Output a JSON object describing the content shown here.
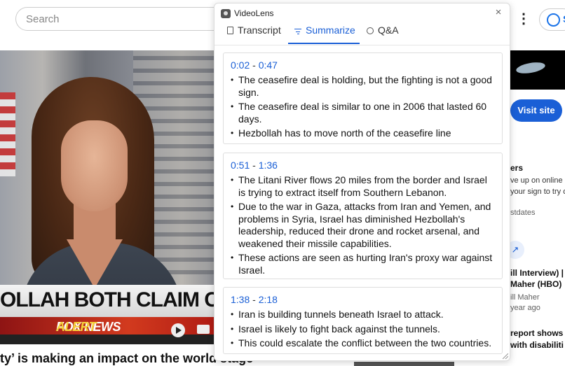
{
  "search": {
    "placeholder": "Search"
  },
  "video": {
    "lower_third": "OLLAH BOTH CLAIM CEASEFIRE",
    "alert_brand": "FOX NEWS",
    "alert_word": "ALERT",
    "title": "ty’ is making an impact on the world stage"
  },
  "side": {
    "visit_site": "Visit site",
    "lines": [
      "ers",
      "ve up on online",
      "your sign to try or",
      "stdates",
      "ill Interview) | R",
      "Maher (HBO)",
      "ill Maher",
      "year ago",
      "report shows",
      "with disabiliti"
    ],
    "profile_initial": "S"
  },
  "popup": {
    "app_title": "VideoLens",
    "tabs": [
      {
        "label": "Transcript",
        "active": false
      },
      {
        "label": "Summarize",
        "active": true
      },
      {
        "label": "Q&A",
        "active": false
      }
    ],
    "sections": [
      {
        "start": "0:02",
        "end": "0:47",
        "points": [
          "The ceasefire deal is holding, but the fighting is not a good sign.",
          "The ceasefire deal is similar to one in 2006 that lasted 60 days.",
          "Hezbollah has to move north of the ceasefire line"
        ]
      },
      {
        "start": "0:51",
        "end": "1:36",
        "points": [
          "The Litani River flows 20 miles from the border and Israel is trying to extract itself from Southern Lebanon.",
          "Due to the war in Gaza, attacks from Iran and Yemen, and problems in Syria, Israel has diminished Hezbollah's leadership, reduced their drone and rocket arsenal, and weakened their missile capabilities.",
          "These actions are seen as hurting Iran's proxy war against Israel."
        ]
      },
      {
        "start": "1:38",
        "end": "2:18",
        "points": [
          "Iran is building tunnels beneath Israel to attack.",
          "Israel is likely to fight back against the tunnels.",
          "This could escalate the conflict between the two countries."
        ]
      }
    ]
  },
  "colors": {
    "accent": "#1a5fd6",
    "alert_red": "#c8261a",
    "alert_yellow": "#f5d23a"
  },
  "icons": [
    "app-logo-icon",
    "close-icon",
    "transcript-icon",
    "summarize-icon",
    "qa-icon",
    "play-icon",
    "captions-icon",
    "more-vert-icon",
    "avatar-icon",
    "external-link-icon",
    "resize-grip-icon"
  ]
}
